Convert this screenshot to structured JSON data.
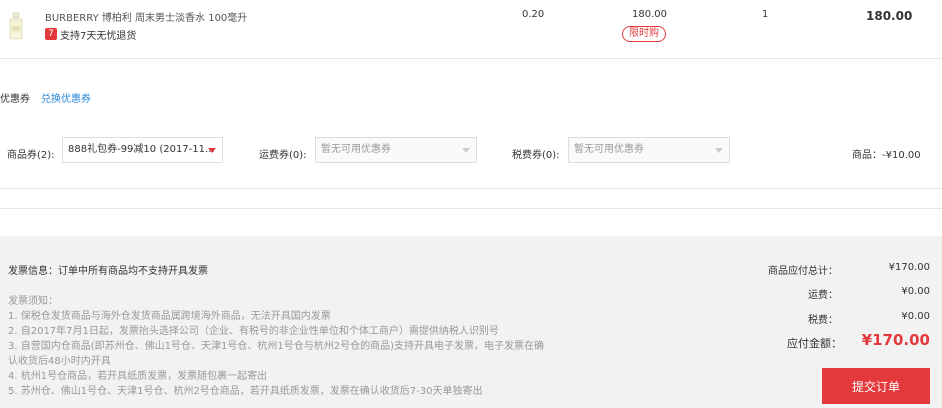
{
  "product": {
    "name": "BURBERRY 博柏利 周末男士淡香水 100毫升",
    "badge": "7",
    "support_text": "支持7天无忧退货",
    "price": "0.20",
    "unit_price": "180.00",
    "limit_tag": "限时购",
    "quantity": "1",
    "subtotal": "180.00",
    "thumb_icon": "perfume-bottle-icon"
  },
  "coupons": {
    "title": "优惠券",
    "redeem_link": "兑换优惠券",
    "goods_label": "商品券(2):",
    "goods_selected": "888礼包券-99减10 (2017-11...",
    "shipping_label": "运费券(0):",
    "shipping_placeholder": "暂无可用优惠券",
    "tax_label": "税费券(0):",
    "tax_placeholder": "暂无可用优惠券",
    "discount_summary": "商品：-¥10.00"
  },
  "invoice": {
    "title": "发票信息：订单中所有商品均不支持开具发票",
    "notes_title": "发票须知：",
    "notes": [
      "1. 保税仓发货商品与海外仓发货商品属跨境海外商品，无法开具国内发票",
      "2. 自2017年7月1日起，发票抬头选择公司（企业、有税号的非企业性单位和个体工商户）需提供纳税人识别号",
      "3. 自营国内仓商品(即苏州仓、佛山1号仓、天津1号仓、杭州1号仓与杭州2号仓的商品)支持开具电子发票，电子发票在确",
      "认收货后48小时内开具",
      "4. 杭州1号仓商品，若开具纸质发票，发票随包裹一起寄出",
      "5. 苏州仓、佛山1号仓、天津1号仓、杭州2号仓商品，若开具纸质发票，发票在确认收货后7-30天单独寄出"
    ]
  },
  "summary": {
    "goods_total_label": "商品应付总计：",
    "goods_total": "¥170.00",
    "shipping_label": "运费：",
    "shipping": "¥0.00",
    "tax_label": "税费：",
    "tax": "¥0.00",
    "payable_label": "应付金额：",
    "payable": "¥170.00",
    "submit_label": "提交订单"
  },
  "colors": {
    "accent": "#e4393c",
    "link": "#2c8ad9",
    "panel_bg": "#f2f2f2"
  }
}
